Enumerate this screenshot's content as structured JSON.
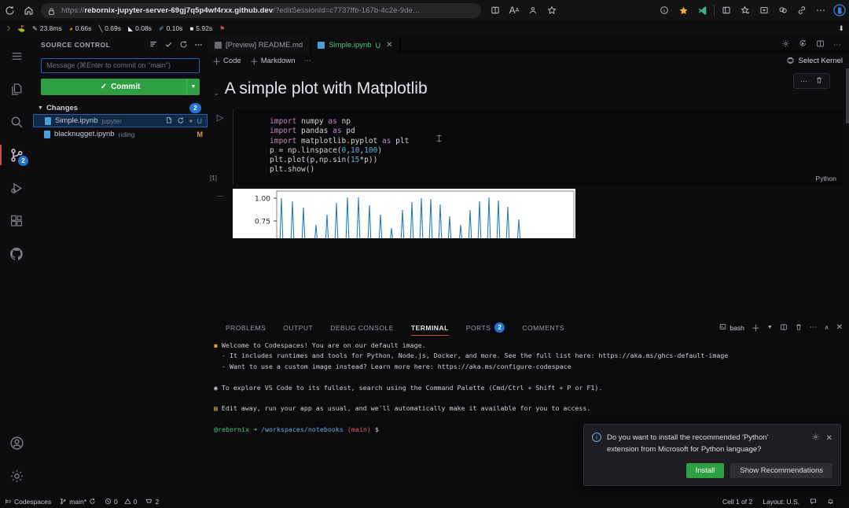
{
  "browser": {
    "url_scheme": "https://",
    "url_host": "rebornix-jupyter-server-69gj7q5p4wf4rxx.github.dev",
    "url_query": "/?editSessionId=c7737ffb-167b-4c2e-9de…",
    "icons": {
      "reload": "reload-icon",
      "home": "home-icon",
      "lock": "lock-icon",
      "split": "split-screen-icon",
      "read_aloud": "read-aloud-icon",
      "profile": "profile-icon",
      "favorite": "favorite-star-icon",
      "info": "info-icon",
      "star_filled": "star-filled-icon",
      "vscode_ext": "vscode-extension-icon",
      "collections": "collections-icon",
      "add_favorite": "add-favorite-icon",
      "browser_essentials": "browser-essentials-icon",
      "split_window": "split-window-icon",
      "link": "link-icon",
      "more": "more-options-icon",
      "copilot": "copilot-icon"
    }
  },
  "perf_bar": {
    "items": [
      {
        "icon": "moon-icon",
        "label": ""
      },
      {
        "icon": "flag-icon",
        "label": ""
      },
      {
        "icon": "pen-icon",
        "label": "23.8ms"
      },
      {
        "icon": "fire-icon",
        "label": "0.66s"
      },
      {
        "icon": "line-icon",
        "label": "0.69s"
      },
      {
        "icon": "shape-icon",
        "label": "0.08s"
      },
      {
        "icon": "pencil-icon",
        "label": "0.10s"
      },
      {
        "icon": "square-icon",
        "label": "5.92s"
      },
      {
        "icon": "bookmark-icon",
        "label": ""
      }
    ]
  },
  "activity_bar": {
    "items": [
      {
        "name": "menu",
        "icon": "hamburger-menu-icon",
        "badge": ""
      },
      {
        "name": "explorer",
        "icon": "files-icon",
        "badge": ""
      },
      {
        "name": "search",
        "icon": "search-icon",
        "badge": ""
      },
      {
        "name": "source-control",
        "icon": "source-control-icon",
        "badge": "2"
      },
      {
        "name": "run-debug",
        "icon": "run-and-debug-icon",
        "badge": ""
      },
      {
        "name": "extensions",
        "icon": "extensions-icon",
        "badge": ""
      },
      {
        "name": "github",
        "icon": "github-icon",
        "badge": ""
      }
    ],
    "bottom": [
      {
        "name": "accounts",
        "icon": "account-icon"
      },
      {
        "name": "settings",
        "icon": "gear-icon"
      }
    ]
  },
  "sidebar": {
    "title": "SOURCE CONTROL",
    "header_actions": [
      "view-and-sort-icon",
      "checkmark-icon",
      "refresh-icon",
      "more-actions-icon"
    ],
    "commit_input_placeholder": "Message (⌘Enter to commit on \"main\")",
    "commit_button": "Commit",
    "commit_check": "✓",
    "changes_label": "Changes",
    "changes_count": "2",
    "files": [
      {
        "name": "Simple.ipynb",
        "folder": "jupyter",
        "selected": true,
        "actions": [
          "open-changes-icon",
          "discard-changes-icon",
          "stage-changes-icon"
        ],
        "status": "U"
      },
      {
        "name": "blacknugget.ipynb",
        "folder": "riding",
        "selected": false,
        "actions": [],
        "status": "M"
      }
    ]
  },
  "editor": {
    "tabs": [
      {
        "label": "[Preview] README.md",
        "active": false,
        "dirty": "",
        "icon": "preview-icon"
      },
      {
        "label": "Simple.ipynb",
        "active": true,
        "dirty": "U",
        "icon": "notebook-icon",
        "close": "✕"
      }
    ],
    "tab_actions": [
      "settings-gear-icon",
      "run-all-icon",
      "split-editor-icon",
      "more-actions-icon"
    ],
    "notebook_toolbar": {
      "add_code": "Code",
      "add_markdown": "Markdown",
      "more": "⋯",
      "kernel_label": "Select Kernel",
      "kernel_icon": "kernel-icon"
    },
    "cell_toolbar": {
      "more": "⋯",
      "delete": "delete-icon"
    },
    "markdown_cell": {
      "title": "A simple plot with Matplotlib",
      "chevron": "⌄"
    },
    "code_cell": {
      "execution_count": "[1]",
      "language": "Python",
      "run_icon": "run-cell-icon",
      "lines": [
        "import numpy as np",
        "import pandas as pd",
        "import matplotlib.pyplot as plt",
        "p = np.linspace(0,10,100)",
        "plt.plot(p,np.sin(15*p))",
        "plt.show()"
      ]
    },
    "output_cell": {
      "gutter": "⋯"
    }
  },
  "chart_data": {
    "type": "line",
    "title": "",
    "xlabel": "",
    "ylabel": "",
    "ytick_labels": [
      "1.00",
      "0.75"
    ],
    "ytick_values": [
      1.0,
      0.75
    ],
    "ylim": [
      0.6,
      1.05
    ],
    "xlim": [
      0,
      10
    ],
    "x_expression": "np.linspace(0,10,100)",
    "y_expression": "np.sin(15*p)",
    "n_points": 100,
    "line_color": "#1f77b4",
    "grid": false,
    "note": "Aliased high-frequency sine: sin(15*p) sampled at 100 points over [0,10]; only the upper portion of the curve is visible in the cropped output."
  },
  "panel": {
    "tabs": [
      {
        "label": "PROBLEMS",
        "active": false,
        "badge": ""
      },
      {
        "label": "OUTPUT",
        "active": false,
        "badge": ""
      },
      {
        "label": "DEBUG CONSOLE",
        "active": false,
        "badge": ""
      },
      {
        "label": "TERMINAL",
        "active": true,
        "badge": ""
      },
      {
        "label": "PORTS",
        "active": false,
        "badge": "2"
      },
      {
        "label": "COMMENTS",
        "active": false,
        "badge": ""
      }
    ],
    "shell": "bash",
    "actions": [
      "new-terminal-icon",
      "chevron-down-icon",
      "split-terminal-icon",
      "kill-terminal-icon",
      "more-actions-icon",
      "maximize-panel-icon",
      "close-panel-icon"
    ],
    "terminal_lines": [
      {
        "icon": "📦",
        "text": "Welcome to Codespaces! You are on our default image.",
        "color": "default"
      },
      {
        "icon": "",
        "text": "  - It includes runtimes and tools for Python, Node.js, Docker, and more. See the full list here: https://aka.ms/ghcs-default-image",
        "color": "default"
      },
      {
        "icon": "",
        "text": "  - Want to use a custom image instead? Learn more here: https://aka.ms/configure-codespace",
        "color": "default"
      },
      {
        "icon": "",
        "text": "",
        "color": "default"
      },
      {
        "icon": "🔍",
        "text": "To explore VS Code to its fullest, search using the Command Palette (Cmd/Ctrl + Shift + P or F1).",
        "color": "default"
      },
      {
        "icon": "",
        "text": "",
        "color": "default"
      },
      {
        "icon": "📋",
        "text": "Edit away, run your app as usual, and we'll automatically make it available for you to access.",
        "color": "default"
      },
      {
        "icon": "",
        "text": "",
        "color": "default"
      }
    ],
    "prompt": {
      "user": "@rebornix",
      "arrow": "➜",
      "path": "/workspaces/notebooks",
      "branch": "(main)",
      "symbol": "$"
    }
  },
  "notification": {
    "icon": "info-icon",
    "message_line1": "Do you want to install the recommended 'Python'",
    "message_line2": "extension from Microsoft for Python language?",
    "gear": "gear-icon",
    "close": "✕",
    "primary_button": "Install",
    "secondary_button": "Show Recommendations"
  },
  "status_bar": {
    "left": [
      {
        "icon": "remote-icon",
        "label": "Codespaces"
      },
      {
        "icon": "branch-icon",
        "label": "main*"
      },
      {
        "icon": "sync-icon",
        "label": ""
      },
      {
        "icon": "error-icon",
        "label": "0"
      },
      {
        "icon": "warning-icon",
        "label": "0"
      },
      {
        "icon": "ports-icon",
        "label": "2"
      }
    ],
    "right": [
      {
        "icon": "",
        "label": "Cell 1 of 2"
      },
      {
        "icon": "",
        "label": "Layout: U.S."
      },
      {
        "icon": "feedback-icon",
        "label": ""
      },
      {
        "icon": "bell-icon",
        "label": ""
      }
    ]
  },
  "colors": {
    "accent_blue": "#2472d4",
    "commit_green": "#2ea043",
    "active_red": "#d14c3a",
    "tab_active_green": "#4ec97a",
    "plot_line": "#1f77b4"
  }
}
